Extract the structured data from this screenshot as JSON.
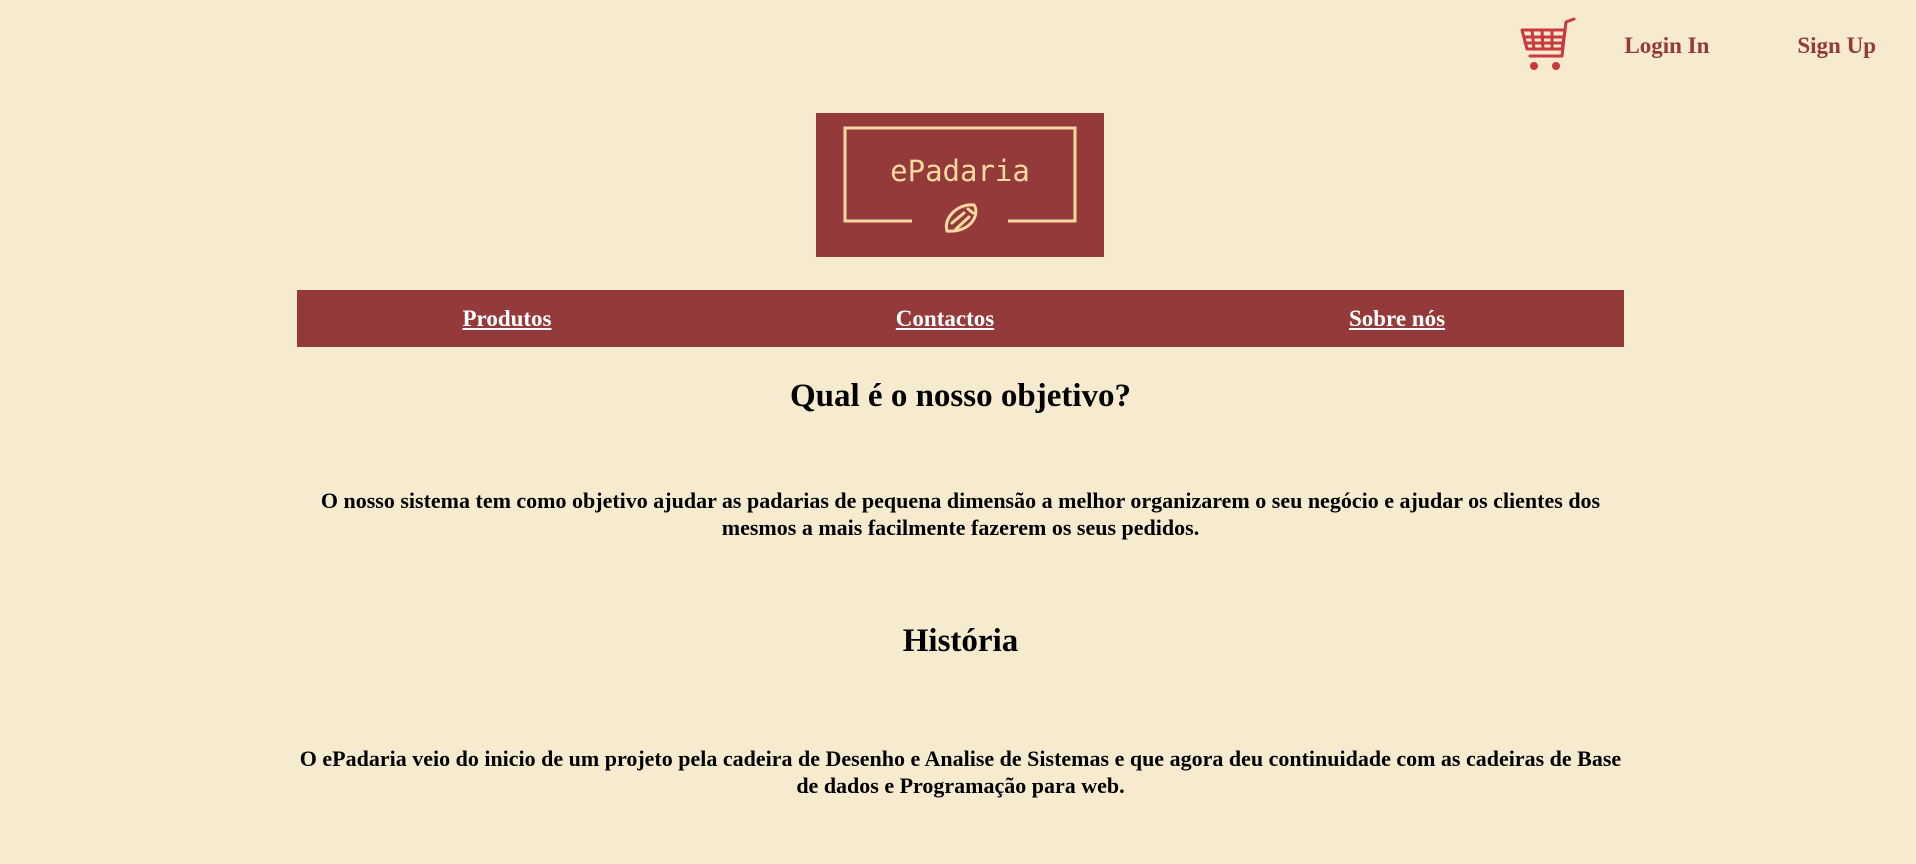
{
  "header": {
    "login_label": "Login In",
    "signup_label": "Sign Up"
  },
  "logo": {
    "text": "ePadaria"
  },
  "nav": {
    "items": [
      {
        "label": "Produtos"
      },
      {
        "label": "Contactos"
      },
      {
        "label": "Sobre nós"
      }
    ]
  },
  "sections": [
    {
      "heading": "Qual é o nosso objetivo?",
      "body": "O nosso sistema tem como objetivo ajudar as padarias de pequena dimensão a melhor organizarem o seu negócio e ajudar os clientes dos mesmos a mais facilmente fazerem os seus pedidos."
    },
    {
      "heading": "História",
      "body": "O ePadaria veio do inicio de um projeto pela cadeira de Desenho e Analise de Sistemas e que agora deu continuidade com as cadeiras de Base de dados e Programação para web."
    }
  ],
  "colors": {
    "background": "#f6ebcf",
    "brand": "#943a3a",
    "logo_accent": "#f8d9a0",
    "nav_text": "#ffffff"
  },
  "icons": {
    "cart": "shopping-cart-icon",
    "logo_mark": "croissant-icon"
  }
}
